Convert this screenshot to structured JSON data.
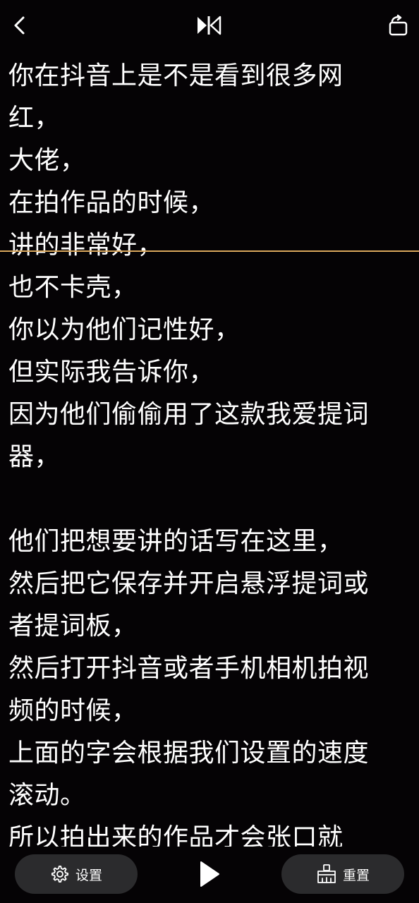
{
  "toolbar": {
    "back_icon": "chevron-left-icon",
    "mirror_icon": "mirror-flip-icon",
    "rotate_icon": "rotate-screen-icon"
  },
  "script": {
    "lines": [
      "你在抖音上是不是看到很多网",
      "红，",
      "大佬，",
      "在拍作品的时候，",
      "讲的非常好，",
      "也不卡壳，",
      "你以为他们记性好，",
      "但实际我告诉你，",
      "因为他们偷偷用了这款我爱提词",
      "器，",
      "",
      "他们把想要讲的话写在这里，",
      "然后把它保存并开启悬浮提词或",
      "者提词板，",
      "然后打开抖音或者手机相机拍视",
      "频的时候，",
      "上面的字会根据我们设置的速度",
      "滚动。",
      "所以拍出来的作品才会张口就"
    ]
  },
  "controls": {
    "settings_label": "设置",
    "settings_icon": "gear-icon",
    "play_icon": "play-icon",
    "reset_label": "重置",
    "reset_icon": "reset-icon"
  },
  "colors": {
    "background": "#050305",
    "text": "#ffffff",
    "guide_line": "#d9a75c",
    "pill_background": "#2b2b2d"
  }
}
